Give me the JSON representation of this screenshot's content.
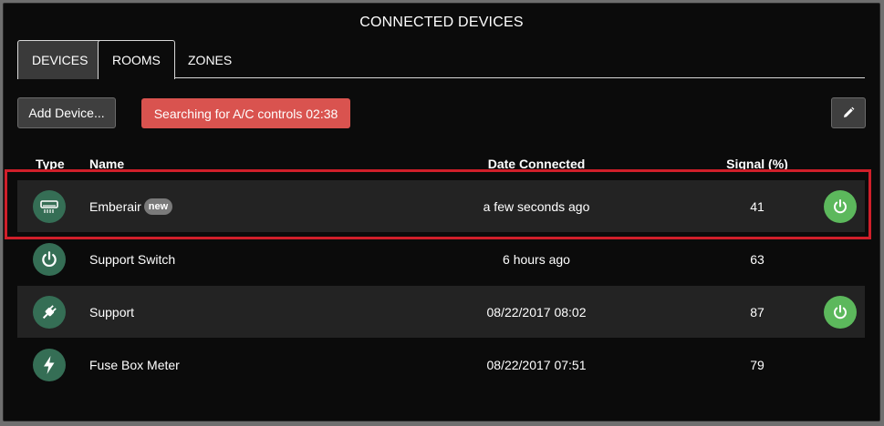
{
  "title": "CONNECTED DEVICES",
  "tabs": [
    {
      "label": "DEVICES",
      "active": true
    },
    {
      "label": "ROOMS",
      "active": false
    },
    {
      "label": "ZONES",
      "active": false
    }
  ],
  "toolbar": {
    "add_label": "Add Device...",
    "search_status": "Searching for A/C controls 02:38",
    "edit_icon": "pencil-icon"
  },
  "table": {
    "headers": {
      "type": "Type",
      "name": "Name",
      "date": "Date Connected",
      "signal": "Signal (%)"
    },
    "rows": [
      {
        "icon": "air-conditioner-icon",
        "name": "Emberair",
        "badge": "new",
        "date": "a few seconds ago",
        "signal": "41",
        "has_power": true
      },
      {
        "icon": "power-icon",
        "name": "Support Switch",
        "badge": "",
        "date": "6 hours ago",
        "signal": "63",
        "has_power": false
      },
      {
        "icon": "plug-icon",
        "name": "Support",
        "badge": "",
        "date": "08/22/2017 08:02",
        "signal": "87",
        "has_power": true
      },
      {
        "icon": "lightning-icon",
        "name": "Fuse Box Meter",
        "badge": "",
        "date": "08/22/2017 07:51",
        "signal": "79",
        "has_power": false
      }
    ]
  },
  "colors": {
    "device_icon_bg": "#356e55",
    "power_button": "#5cb85c",
    "search_status_bg": "#d9534f",
    "highlight": "#d01f2a"
  }
}
